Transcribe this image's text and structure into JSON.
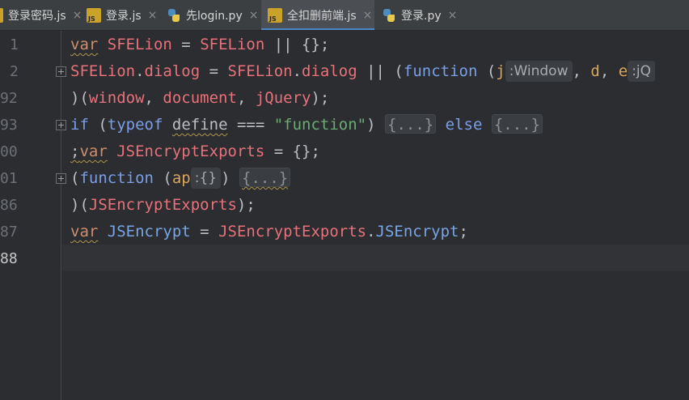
{
  "tabs": [
    {
      "label": "登录密码.js",
      "icon": "js-file-icon",
      "active": false
    },
    {
      "label": "登录.js",
      "icon": "js-file-icon",
      "active": false
    },
    {
      "label": "先login.py",
      "icon": "python-file-icon",
      "active": false
    },
    {
      "label": "全扣删前端.js",
      "icon": "js-file-icon",
      "active": true
    },
    {
      "label": "登录.py",
      "icon": "python-file-icon",
      "active": false
    }
  ],
  "close_glyph": "×",
  "gutter": {
    "line_numbers": [
      "1",
      "2",
      "92",
      "93",
      "00",
      "01",
      "86",
      "87",
      "88"
    ]
  },
  "code": {
    "l1": {
      "kw": "var",
      "name": "SFELion",
      "eq": " = ",
      "rhs": "SFELion",
      "tail": " || {};"
    },
    "l2": {
      "obj": "SFELion",
      "dot": ".",
      "prop": "dialog",
      "eq": " = ",
      "obj2": "SFELion",
      "dot2": ".",
      "prop2": "dialog",
      "mid": " || (",
      "fn": "function",
      "open": " (",
      "p1": "j",
      "hint1": ":Window",
      "sep1": ", ",
      "p2": "d",
      "sep2": ", ",
      "p3": "e",
      "hint2": ":jQ"
    },
    "l3": {
      "open": ")(",
      "a1": "window",
      "c1": ", ",
      "a2": "document",
      "c2": ", ",
      "a3": "jQuery",
      "close": ");"
    },
    "l4": {
      "kw": "if",
      "open": " (",
      "kw2": "typeof",
      "sp": " ",
      "name": "define",
      "op": " === ",
      "str": "\"function\"",
      "close": ") ",
      "fold1": "{...}",
      "else": " else ",
      "fold2": "{...}"
    },
    "l5": {
      "semi": ";",
      "kw": "var",
      "sp": " ",
      "name": "JSEncryptExports",
      "tail": " = {};"
    },
    "l6": {
      "open": "(",
      "fn": "function",
      "open2": " (",
      "p": "ap",
      "hint": ":{}",
      "close": ") ",
      "fold": "{...}"
    },
    "l7": {
      "open": ")(",
      "arg": "JSEncryptExports",
      "close": ");"
    },
    "l8": {
      "kw": "var",
      "sp": " ",
      "name": "JSEncrypt",
      "eq": " = ",
      "obj": "JSEncryptExports",
      "dot": ".",
      "prop": "JSEncrypt",
      "semi": ";"
    }
  }
}
